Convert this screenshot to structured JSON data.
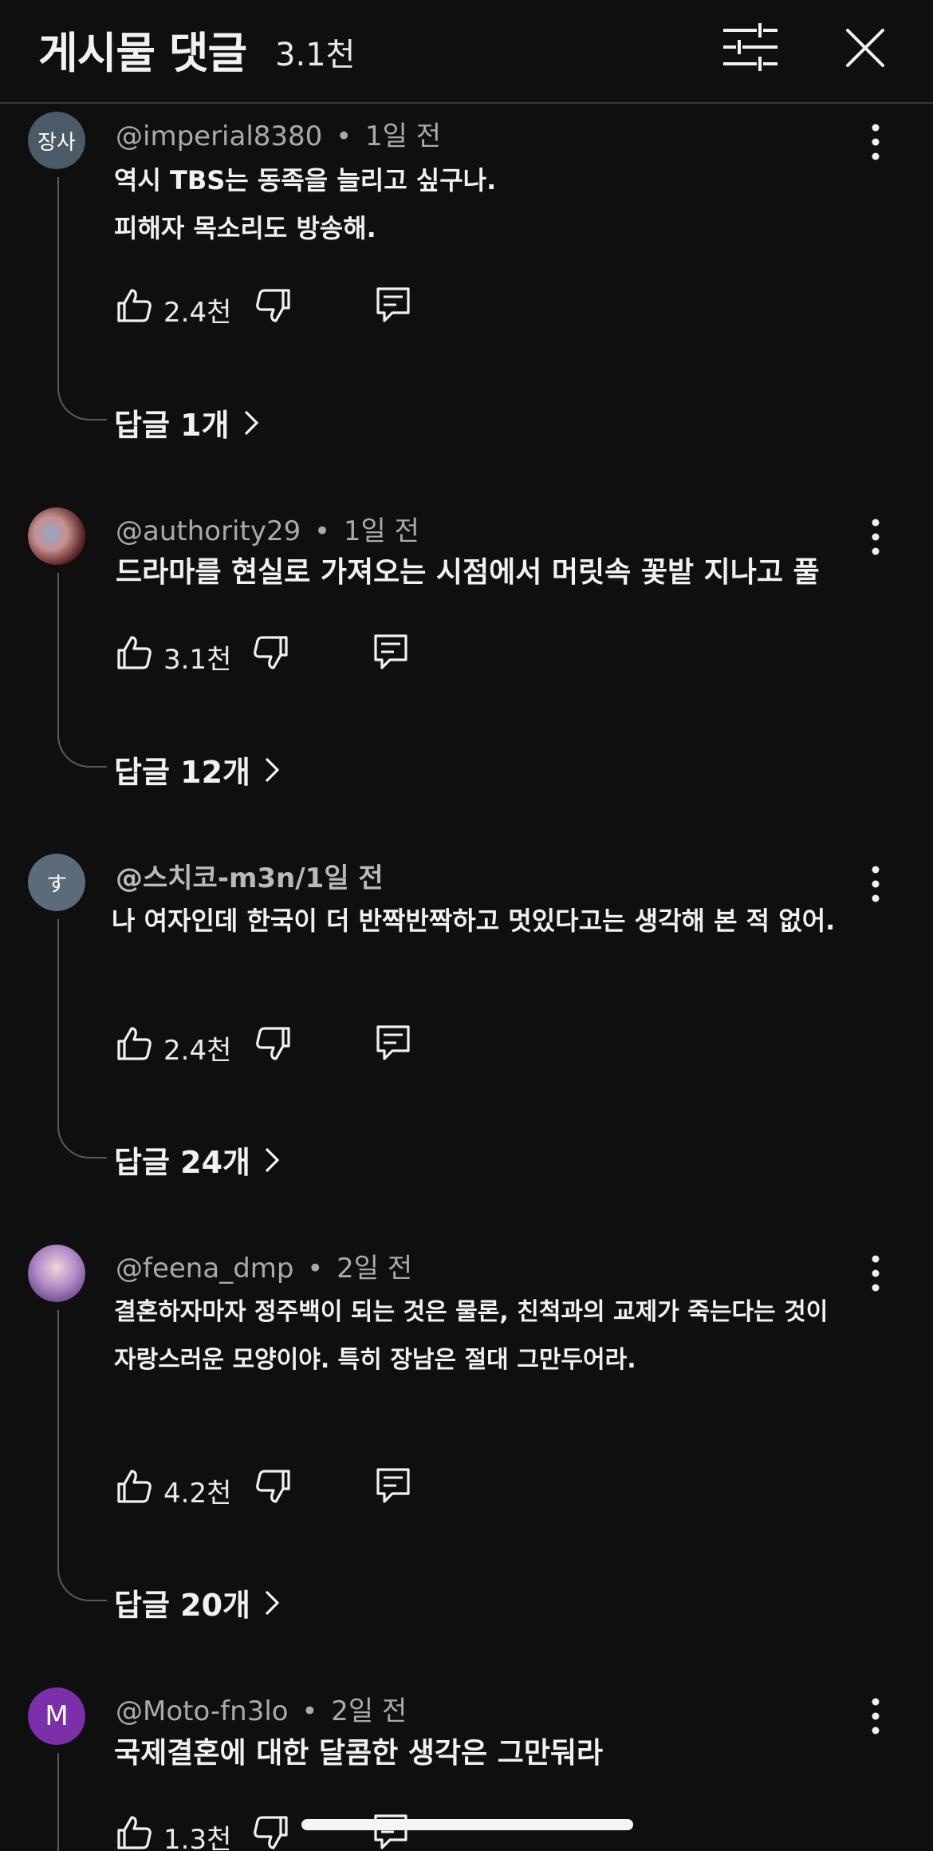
{
  "header": {
    "title": "게시물 댓글",
    "count": "3.1천",
    "filter_icon": "sliders-icon",
    "close_icon": "close-icon"
  },
  "comments": [
    {
      "avatar_text": "장사",
      "avatar_color": "#4a5a66",
      "author": "@imperial8380",
      "time": "1일 전",
      "lines": [
        "역시 TBS는 동족을 늘리고 싶구나.",
        "피해자 목소리도 방송해."
      ],
      "likes": "2.4천",
      "replies": "답글 1개"
    },
    {
      "avatar_text": "",
      "avatar_color": "#6b3b3b",
      "author": "@authority29",
      "time": "1일 전",
      "lines": [
        "드라마를 현실로 가져오는 시점에서 머릿속 꽃밭 지나고 풀"
      ],
      "likes": "3.1천",
      "replies": "답글 12개"
    },
    {
      "avatar_text": "す",
      "avatar_color": "#5b6b78",
      "author": "@스치코-m3n/1일 전",
      "time": "",
      "lines": [
        "나 여자인데 한국이 더 반짝반짝하고 멋있다고는 생각해 본 적 없어."
      ],
      "likes": "2.4천",
      "replies": "답글 24개"
    },
    {
      "avatar_text": "",
      "avatar_color": "#a58bc4",
      "author": "@feena_dmp",
      "time": "2일 전",
      "lines": [
        "결혼하자마자 정주백이 되는 것은 물론, 친척과의 교제가 죽는다는 것이",
        "자랑스러운 모양이야. 특히 장남은 절대 그만두어라."
      ],
      "likes": "4.2천",
      "replies": "답글 20개"
    },
    {
      "avatar_text": "M",
      "avatar_color": "#7b2fa8",
      "author": "@Moto-fn3lo",
      "time": "2일 전",
      "lines": [
        "국제결혼에 대한 달콤한 생각은 그만둬라"
      ],
      "likes": "1.3천",
      "replies": ""
    }
  ]
}
